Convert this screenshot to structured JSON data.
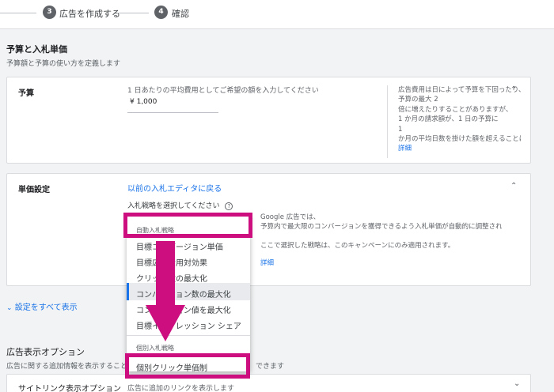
{
  "stepper": {
    "step3_num": "3",
    "step3_label": "広告を作成する",
    "step4_num": "4",
    "step4_label": "確認"
  },
  "budget_section": {
    "title": "予算と入札単価",
    "subtitle": "予算額と予算の使い方を定義します"
  },
  "budget_card": {
    "label": "予算",
    "prompt": "1 日あたりの平均費用としてご希望の額を入力してください",
    "amount_value": "¥ 1,000",
    "help_lines": [
      "広告費用は日によって予算を下回ったり、",
      "予算の最大 2",
      "倍に増えたりすることがありますが、",
      "1 か月の請求額が、1 日の予算に",
      "1",
      "か月の平均日数を掛けた額を超えることはありません"
    ],
    "help_link": "詳細"
  },
  "bid_card": {
    "label": "単価設定",
    "editor_link": "以前の入札エディタに戻る",
    "strategy_prompt": "入札戦略を選択してください",
    "help_lines": [
      "Google 広告では、",
      "予算内で最大限のコンバージョンを獲得できるよう入札単価が自動的に調整されます",
      "",
      "ここで選択した戦略は、このキャンペーンにのみ適用されます。"
    ],
    "help_link": "詳細"
  },
  "show_all_settings": "設定をすべて表示",
  "ad_extensions": {
    "title": "広告表示オプション",
    "subtitle_left": "広告に関する追加情報を表示することで",
    "subtitle_right": "できます",
    "sitelink_label": "サイトリンク表示オプション",
    "sitelink_desc": "広告に追加のリンクを表示します"
  },
  "dropdown": {
    "auto_header": "自動入札戦略",
    "auto_items": [
      "目標コンバージョン単価",
      "目標広告費用対効果",
      "クリック数の最大化",
      "コンバージョン数の最大化",
      "コンバージョン値を最大化",
      "目標インプレッション シェア"
    ],
    "manual_header": "個別入札戦略",
    "manual_item": "個別クリック単価制"
  },
  "colors": {
    "highlight": "#cc0e7e",
    "link": "#1a73e8",
    "selected_indicator": "#1a73e8"
  },
  "icons": [
    "chevron-up-icon",
    "chevron-down-icon",
    "help-circle-icon"
  ]
}
